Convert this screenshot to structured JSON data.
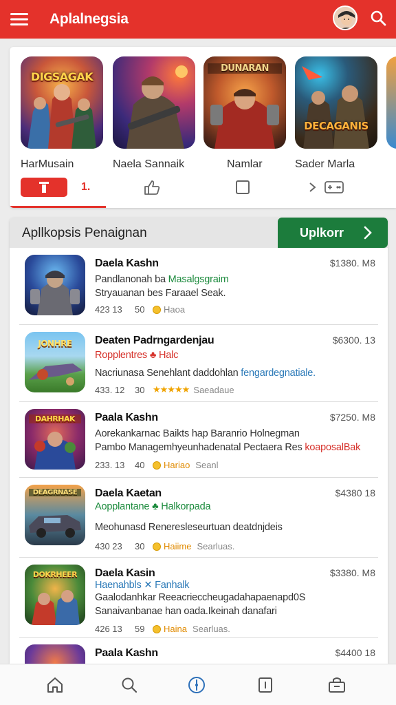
{
  "app": {
    "title": "Aplalnegsia"
  },
  "featured": {
    "items": [
      {
        "name": "HarMusain",
        "art_text": "DIGSAGAK"
      },
      {
        "name": "Naela Sannaik",
        "art_text": ""
      },
      {
        "name": "Namlar",
        "art_text": "DUNARAN"
      },
      {
        "name": "Sader Marla",
        "art_text": "DECAGANIS"
      }
    ],
    "counter": "1."
  },
  "section": {
    "title": "Apllkopsis  Penaignan",
    "upgrade_label": "Uplkorr"
  },
  "list": [
    {
      "title": "Daela Kashn",
      "price": "$1380. M8",
      "line1_plain": "Pandlanonah ba ",
      "line1_hl": "Masalgsgraim",
      "line1_hl_color": "green",
      "line2": "Stryauanan bes Faraael Seak.",
      "line3": "",
      "meta_n1": "423  13",
      "meta_n2": "50",
      "meta_badge": "",
      "meta_stars": "",
      "meta_tail": "Haoa",
      "art_text": ""
    },
    {
      "title": "Deaten Padrngardenjau",
      "price": "$6300. 13",
      "line1_plain": "",
      "line1_hl": "Ropplentres  ♣  Halc",
      "line1_hl_color": "red",
      "line2": "Nacriunasa Senehlant daddohlan ",
      "line2_hl": "fengardegnatiale.",
      "line3": "",
      "meta_n1": "433. 12",
      "meta_n2": "30",
      "meta_badge": "",
      "meta_stars": "★★★★★",
      "meta_tail": "Saeadaue",
      "art_text": "JONHRE"
    },
    {
      "title": "Paala Kashn",
      "price": "$7250. M8",
      "line1_plain": "Aorekankarnac Baikts hap Baranrio Holnegman",
      "line1_hl": "",
      "line1_hl_color": "green",
      "line2": "Pambo Managemhyeunhadenatal Pectaera Res ",
      "line2_hl": "koaposalBak",
      "line3": "",
      "meta_n1": "233. 13",
      "meta_n2": "40",
      "meta_badge": "Hariao",
      "meta_stars": "",
      "meta_tail": "Seanl",
      "art_text": "DAHRHAK"
    },
    {
      "title": "Daela Kaetan",
      "price": "$4380 18",
      "line1_plain": "",
      "line1_hl": "Aopplantane  ♣  Halkorpada",
      "line1_hl_color": "green",
      "line2": "Meohunasd Reneresleseurtuan deatdnjdeis",
      "line2_hl": "",
      "line3": "",
      "meta_n1": "430  23",
      "meta_n2": "30",
      "meta_badge": "Haiime",
      "meta_stars": "",
      "meta_tail": "Searluas.",
      "art_text": "DEAGRNASE"
    },
    {
      "title": "Daela Kasin",
      "price": "$3380. M8",
      "line1_plain": "",
      "line1_hl": "Haenahbls  ✕  Fanhalk",
      "line1_hl_color": "blue",
      "line2": "Gaalodanhkar Reeacrieccheugadahapaenapd0S",
      "line2_hl": "",
      "line3": "Sanaivanbanae han oada.Ikeinah danafari",
      "meta_n1": "426  13",
      "meta_n2": "59",
      "meta_badge": "Haina",
      "meta_stars": "",
      "meta_tail": "Searluas.",
      "art_text": "DOKRHEER"
    },
    {
      "title": "Paala Kashn",
      "price": "$4400 18",
      "line1_plain": "",
      "line1_hl": "",
      "line1_hl_color": "green",
      "line2": "",
      "line2_hl": "",
      "line3": "",
      "meta_n1": "",
      "meta_n2": "",
      "meta_badge": "",
      "meta_stars": "",
      "meta_tail": "",
      "art_text": ""
    }
  ],
  "colors": {
    "brand_red": "#e4322b",
    "upgrade_green": "#1c7c3c",
    "nav_active_blue": "#2c6fb8"
  },
  "icons": {
    "topbar": [
      "hamburger-menu-icon",
      "user-avatar",
      "search-icon"
    ],
    "featured_actions": [
      "download-icon",
      "thumbs-up-icon",
      "checkbox-icon",
      "controller-icon"
    ],
    "bottom_nav": [
      "home-icon",
      "search-icon",
      "compass-icon",
      "bookmark-icon",
      "inbox-icon"
    ]
  }
}
